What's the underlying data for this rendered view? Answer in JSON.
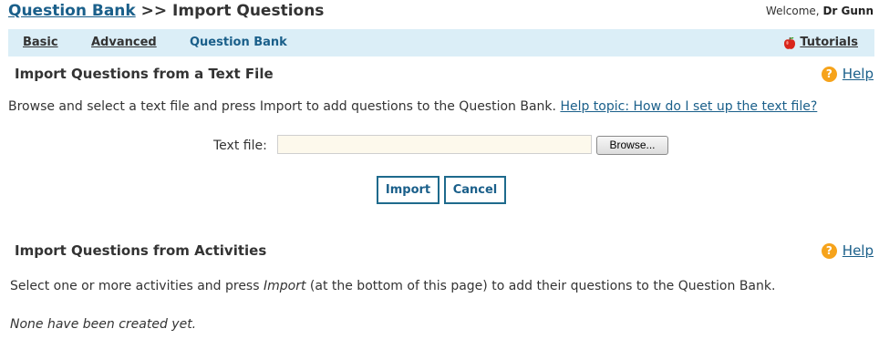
{
  "header": {
    "breadcrumb_link": "Question Bank",
    "breadcrumb_sep": ">>",
    "breadcrumb_current": "Import Questions",
    "welcome_prefix": "Welcome,",
    "user_name": "Dr Gunn"
  },
  "nav": {
    "items": [
      {
        "label": "Basic"
      },
      {
        "label": "Advanced"
      },
      {
        "label": "Question Bank"
      }
    ],
    "active_item": "Question Bank",
    "tutorials_label": "Tutorials"
  },
  "text_import": {
    "title": "Import Questions from a Text File",
    "help_label": "Help",
    "description": "Browse and select a text file and press Import to add questions to the Question Bank.",
    "help_topic_link": "Help topic: How do I set up the text file?",
    "file_label": "Text file:",
    "file_value": "",
    "browse_label": "Browse...",
    "import_label": "Import",
    "cancel_label": "Cancel"
  },
  "activity_import": {
    "title": "Import Questions from Activities",
    "help_label": "Help",
    "desc_part1": "Select one or more activities and press ",
    "desc_italic": "Import",
    "desc_part2": " (at the bottom of this page) to add their questions to the Question Bank.",
    "empty_message": "None have been created yet."
  },
  "colors": {
    "link": "#1a5f8a",
    "nav_background": "#dbeef7",
    "help_icon": "#f6a31b",
    "file_input_bg": "#fdf9ec",
    "button_border": "#1e6a8c"
  },
  "icons": {
    "help": "question-circle-icon",
    "tutorials": "apple-icon"
  }
}
